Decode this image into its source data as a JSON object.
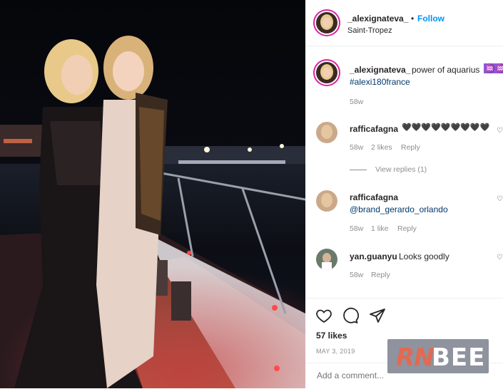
{
  "header": {
    "username": "_alexignateva_",
    "separator": "•",
    "follow_label": "Follow",
    "location": "Saint-Tropez"
  },
  "caption": {
    "username": "_alexignateva_",
    "text": "power of aquarius",
    "emoji": "♒♒",
    "hashtag": "#alexi180france",
    "time": "58w"
  },
  "comments": [
    {
      "username": "rafficafagna",
      "text": "🖤🖤🖤🖤🖤🖤🖤🖤🖤",
      "time": "58w",
      "likes": "2 likes",
      "reply": "Reply",
      "view_replies": "View replies (1)"
    },
    {
      "username": "rafficafagna",
      "text": "@brand_gerardo_orlando",
      "time": "58w",
      "likes": "1 like",
      "reply": "Reply"
    },
    {
      "username": "yan.guanyu",
      "text": "Looks goodly",
      "time": "58w",
      "reply": "Reply"
    }
  ],
  "actions": {
    "likes": "57 likes",
    "date": "MAY 3, 2019"
  },
  "add_comment": {
    "placeholder": "Add a comment..."
  },
  "watermark": {
    "part1": "RN",
    "part2": "BEE"
  },
  "icons": [
    "heart-icon",
    "comment-icon",
    "share-icon",
    "comment-like-icon"
  ]
}
